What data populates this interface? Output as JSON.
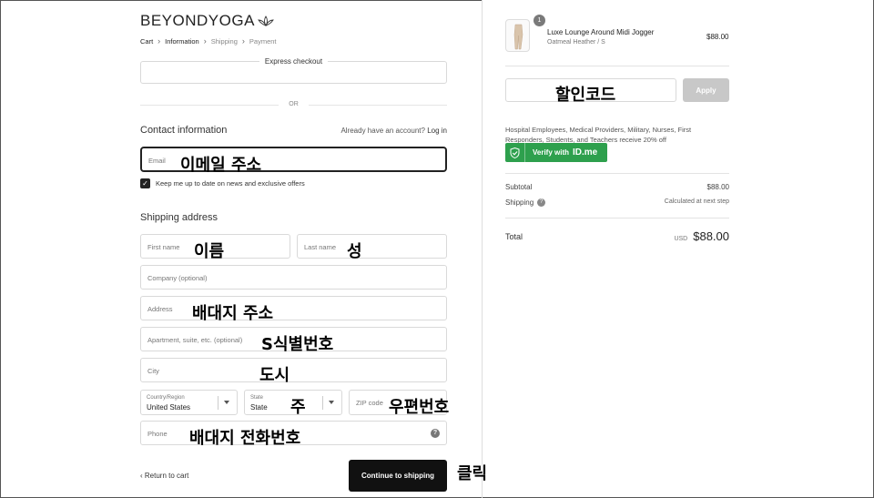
{
  "brand": {
    "logo_text": "BEYONDYOGA"
  },
  "breadcrumb": [
    {
      "label": "Cart"
    },
    {
      "label": "Information"
    },
    {
      "label": "Shipping"
    },
    {
      "label": "Payment"
    }
  ],
  "express": {
    "label": "Express checkout",
    "or": "OR"
  },
  "contact": {
    "title": "Contact information",
    "login_prompt": "Already have an account?",
    "login_link": "Log in",
    "email_placeholder": "Email",
    "email_annotation": "이메일 주소",
    "newsletter_label": "Keep me up to date on news and exclusive offers",
    "newsletter_checked": true
  },
  "shipping": {
    "title": "Shipping address",
    "first_name": {
      "placeholder": "First name",
      "annotation": "이름"
    },
    "last_name": {
      "placeholder": "Last name",
      "annotation": "성"
    },
    "company": {
      "placeholder": "Company (optional)"
    },
    "address": {
      "placeholder": "Address",
      "annotation": "배대지 주소"
    },
    "apartment": {
      "placeholder": "Apartment, suite, etc. (optional)",
      "annotation": "S식별번호"
    },
    "city": {
      "placeholder": "City",
      "annotation": "도시"
    },
    "country": {
      "label": "Country/Region",
      "value": "United States"
    },
    "state": {
      "label": "State",
      "value": "State",
      "annotation": "주"
    },
    "zip": {
      "placeholder": "ZIP code",
      "annotation": "우편번호"
    },
    "phone": {
      "placeholder": "Phone",
      "annotation": "배대지 전화번호"
    }
  },
  "footer": {
    "return_label": "‹ Return to cart",
    "continue_label": "Continue to shipping",
    "click_annotation": "클릭"
  },
  "order": {
    "item": {
      "quantity": "1",
      "name": "Luxe Lounge Around Midi Jogger",
      "variant": "Oatmeal Heather / S",
      "price": "$88.00"
    },
    "discount_annotation": "할인코드",
    "apply_label": "Apply",
    "promo_text": "Hospital Employees, Medical Providers, Military, Nurses, First Responders, Students, and Teachers receive 20% off",
    "idme": {
      "verify_label": "Verify with",
      "logo": "ID.me"
    },
    "subtotal_label": "Subtotal",
    "subtotal_value": "$88.00",
    "shipping_label": "Shipping",
    "shipping_value": "Calculated at next step",
    "total_label": "Total",
    "total_currency": "USD",
    "total_value": "$88.00"
  },
  "colors": {
    "accent": "#111111",
    "idme_green": "#2ea04d",
    "apply_disabled": "#c8c8c8"
  }
}
